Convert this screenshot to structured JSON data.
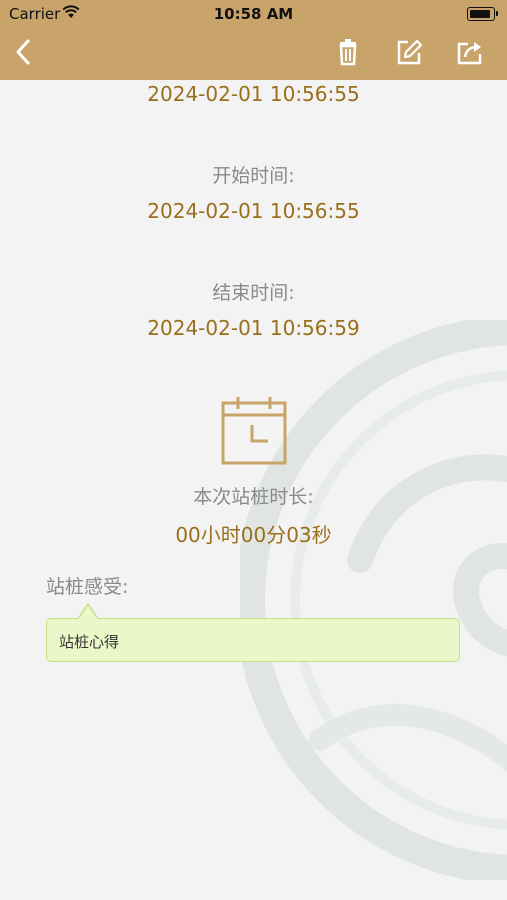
{
  "status_bar": {
    "carrier": "Carrier",
    "time": "10:58 AM"
  },
  "nav": {
    "icons": [
      "back-icon",
      "trash-icon",
      "edit-icon",
      "share-icon"
    ],
    "bar_color": "#c9a46a"
  },
  "record": {
    "top_value": "2024-02-01 10:56:55",
    "start_label": "开始时间:",
    "start_value": "2024-02-01 10:56:55",
    "end_label": "结束时间:",
    "end_value": "2024-02-01 10:56:59",
    "duration_label": "本次站桩时长:",
    "duration_value": "00小时00分03秒"
  },
  "feeling": {
    "label": "站桩感受:",
    "text": "站桩心得"
  },
  "colors": {
    "accent": "#9a6f1c",
    "calendar": "#c9a46a",
    "bubble_bg": "#ecf7c9"
  }
}
